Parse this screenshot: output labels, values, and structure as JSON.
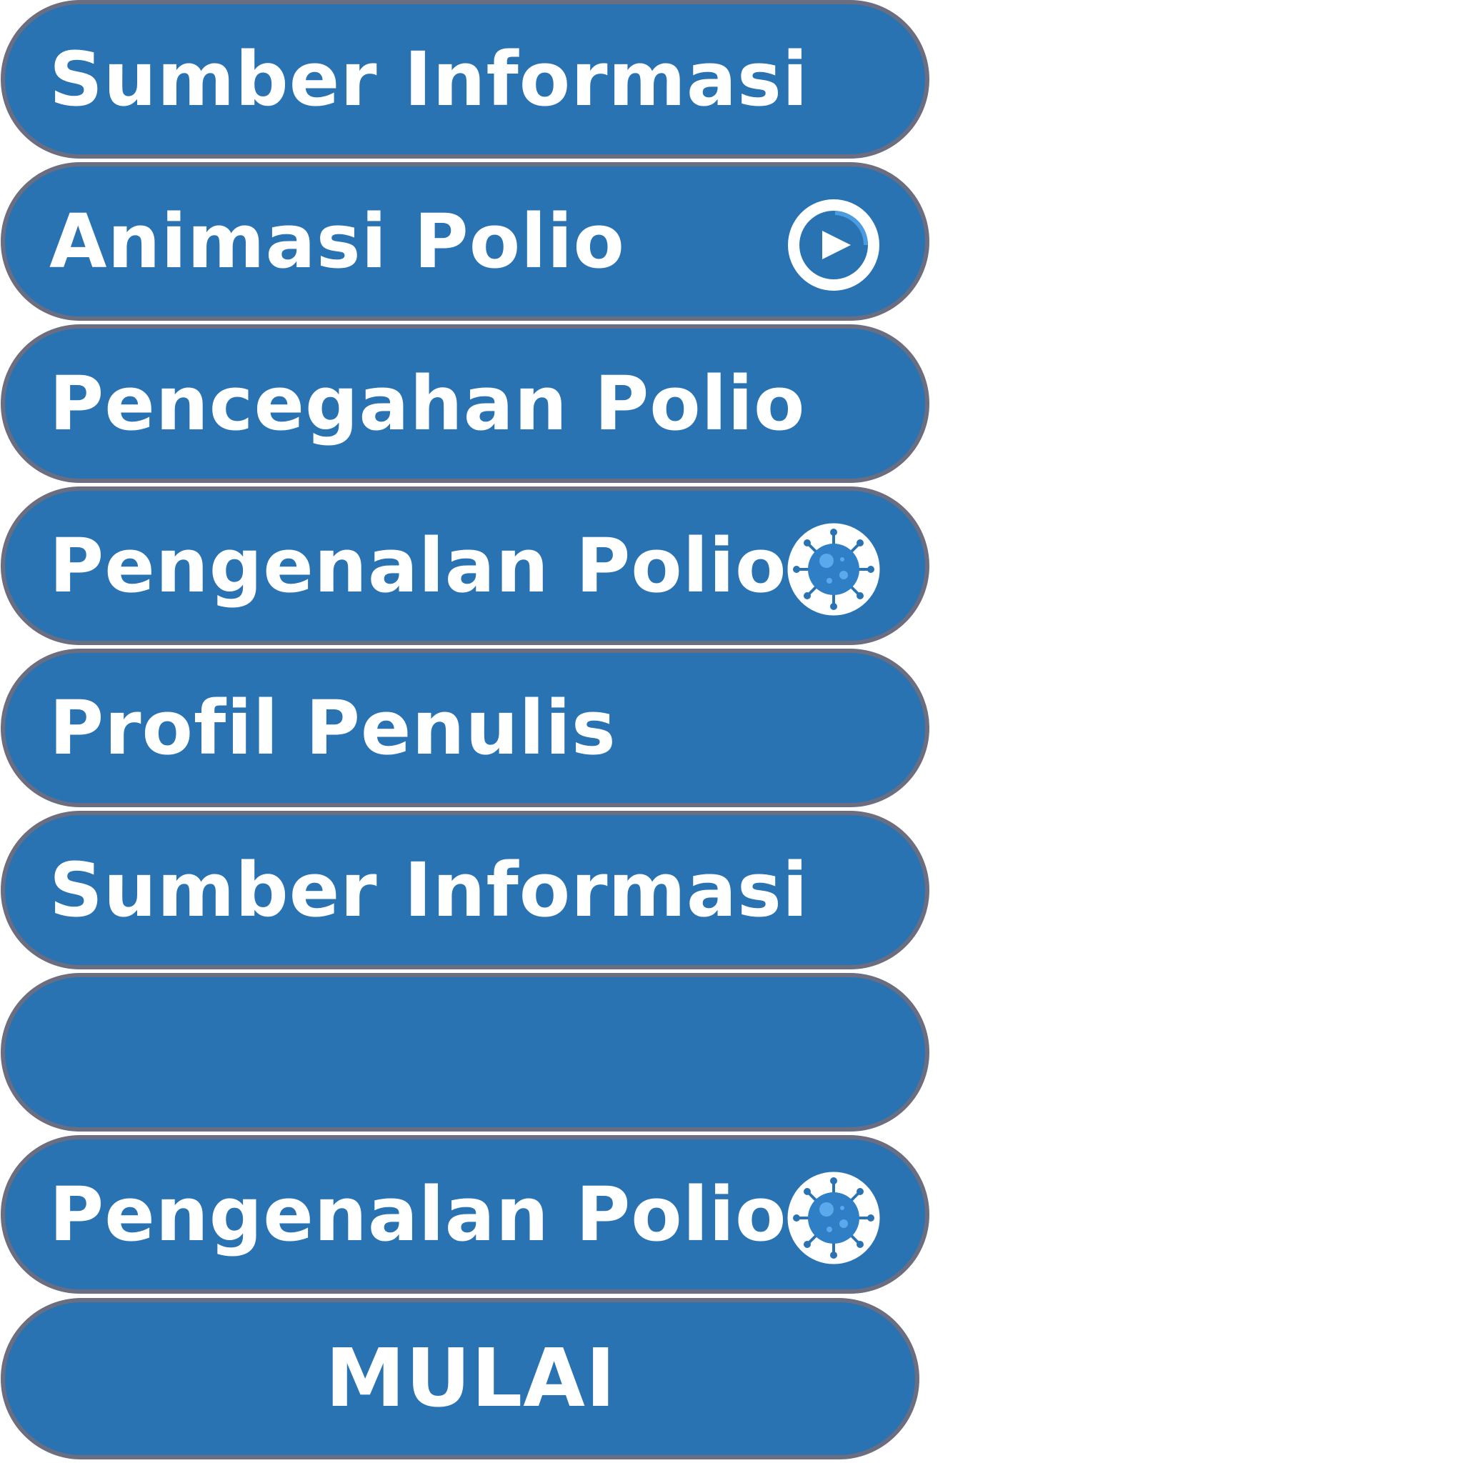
{
  "colors": {
    "button_fill": "#2a73b3",
    "button_border": "#6a6e80",
    "label_text": "#ffffff",
    "icon_accent": "#3b8fd6"
  },
  "menu": {
    "items": [
      {
        "label": "Sumber Informasi",
        "icon": ""
      },
      {
        "label": "Animasi Polio",
        "icon": "play-icon"
      },
      {
        "label": "Pencegahan Polio",
        "icon": ""
      },
      {
        "label": "Pengenalan Polio",
        "icon": "virus-icon"
      },
      {
        "label": "Profil Penulis",
        "icon": ""
      },
      {
        "label": "Sumber Informasi",
        "icon": ""
      },
      {
        "label": "",
        "icon": ""
      },
      {
        "label": "Pengenalan Polio",
        "icon": "virus-icon"
      }
    ],
    "start_button": {
      "label": "MULAI"
    }
  }
}
